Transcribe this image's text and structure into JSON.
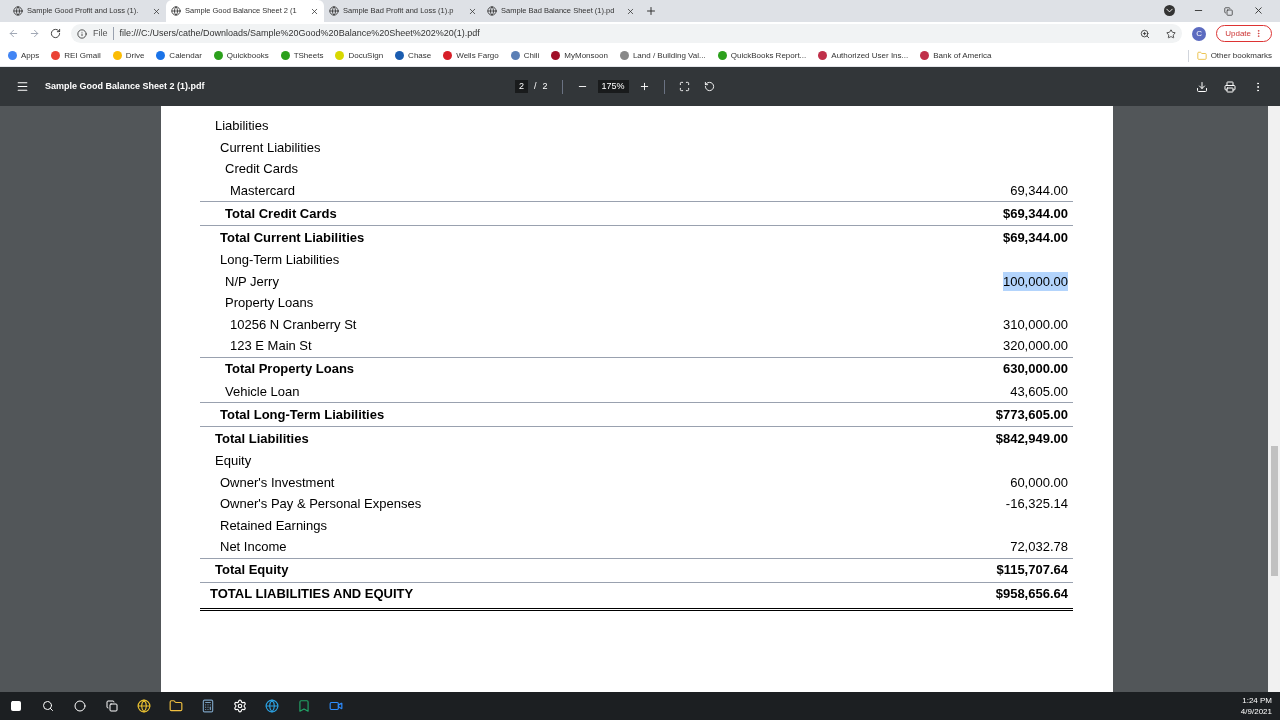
{
  "tabs": [
    {
      "label": "Sample Good Profit and Loss (1).",
      "selected": false
    },
    {
      "label": "Sample Good Balance Sheet 2 (1",
      "selected": true
    },
    {
      "label": "Sample Bad Profit and Loss (1).p",
      "selected": false
    },
    {
      "label": "Sample Bad Balance Sheet (1).pd",
      "selected": false
    }
  ],
  "address": {
    "scheme": "File",
    "url": "file:///C:/Users/cathe/Downloads/Sample%20Good%20Balance%20Sheet%202%20(1).pdf"
  },
  "profile_initial": "C",
  "update_button": "Update",
  "bookmarks": [
    {
      "label": "Apps",
      "color": "#4285f4"
    },
    {
      "label": "REI Gmail",
      "color": "#ea4335"
    },
    {
      "label": "Drive",
      "color": "#fbbc04"
    },
    {
      "label": "Calendar",
      "color": "#1a73e8"
    },
    {
      "label": "Quickbooks",
      "color": "#2ca01c"
    },
    {
      "label": "TSheets",
      "color": "#2ca01c"
    },
    {
      "label": "DocuSign",
      "color": "#d8d800"
    },
    {
      "label": "Chase",
      "color": "#1a5cb0"
    },
    {
      "label": "Wells Fargo",
      "color": "#d71e28"
    },
    {
      "label": "Chili",
      "color": "#5b7fb5"
    },
    {
      "label": "MyMonsoon",
      "color": "#a01028"
    },
    {
      "label": "Land / Building Val...",
      "color": "#888888"
    },
    {
      "label": "QuickBooks Report...",
      "color": "#2ca01c"
    },
    {
      "label": "Authorized User Ins...",
      "color": "#c0304a"
    },
    {
      "label": "Bank of America",
      "color": "#c0304a"
    }
  ],
  "other_bookmarks": "Other bookmarks",
  "pdf_toolbar": {
    "title": "Sample Good Balance Sheet 2 (1).pdf",
    "page": "2",
    "page_separator": "/",
    "page_count": "2",
    "zoom": "175%"
  },
  "report": {
    "sections": [
      {
        "label": "Liabilities",
        "children": [
          {
            "label": "Current Liabilities",
            "children": [
              {
                "label": "Credit Cards",
                "children": [
                  {
                    "label": "Mastercard",
                    "amount": "69,344.00"
                  }
                ],
                "total": {
                  "label": "Total Credit Cards",
                  "amount": "$69,344.00"
                }
              }
            ],
            "total": {
              "label": "Total Current Liabilities",
              "amount": "$69,344.00"
            }
          },
          {
            "label": "Long-Term Liabilities",
            "children": [
              {
                "label": "N/P Jerry",
                "amount": "100,000.00",
                "highlighted": true
              },
              {
                "label": "Property Loans",
                "children": [
                  {
                    "label": "10256 N Cranberry St",
                    "amount": "310,000.00"
                  },
                  {
                    "label": "123 E Main St",
                    "amount": "320,000.00"
                  }
                ],
                "total": {
                  "label": "Total Property Loans",
                  "amount": "630,000.00"
                }
              },
              {
                "label": "Vehicle Loan",
                "amount": "43,605.00"
              }
            ],
            "total": {
              "label": "Total Long-Term Liabilities",
              "amount": "$773,605.00"
            }
          }
        ],
        "total": {
          "label": "Total Liabilities",
          "amount": "$842,949.00"
        }
      },
      {
        "label": "Equity",
        "children": [
          {
            "label": "Owner's Investment",
            "amount": "60,000.00"
          },
          {
            "label": "Owner's Pay & Personal Expenses",
            "amount": "-16,325.14"
          },
          {
            "label": "Retained Earnings"
          },
          {
            "label": "Net Income",
            "amount": "72,032.78"
          }
        ],
        "total": {
          "label": "Total Equity",
          "amount": "$115,707.64"
        }
      }
    ],
    "grand_total": {
      "label": "TOTAL LIABILITIES AND EQUITY",
      "amount": "$958,656.64"
    }
  },
  "taskbar": {
    "clock_time": "1:24 PM",
    "clock_date": "4/9/2021"
  }
}
